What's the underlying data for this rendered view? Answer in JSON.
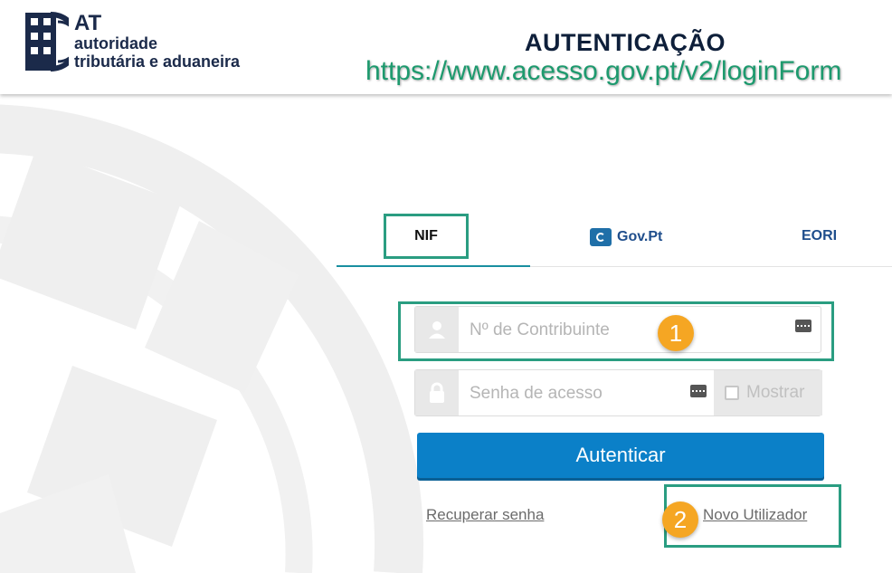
{
  "header": {
    "logo": {
      "abbr": "AT",
      "line1": "autoridade",
      "line2": "tributária e aduaneira"
    },
    "title": "AUTENTICAÇÃO",
    "url": "https://www.acesso.gov.pt/v2/loginForm"
  },
  "tabs": [
    {
      "label": "NIF",
      "active": true
    },
    {
      "label": "Gov.Pt",
      "icon": "govpt-logo-icon"
    },
    {
      "label": "EORI"
    }
  ],
  "form": {
    "nif": {
      "placeholder": "Nº de Contribuinte",
      "value": "",
      "icon": "user-icon",
      "keypad_icon": "keypad-icon"
    },
    "password": {
      "placeholder": "Senha de acesso",
      "value": "",
      "icon": "lock-icon",
      "keypad_icon": "keypad-icon"
    },
    "show_label": "Mostrar",
    "submit_label": "Autenticar",
    "recover_label": "Recuperar senha",
    "new_user_label": "Novo Utilizador"
  },
  "annotations": [
    {
      "number": "1"
    },
    {
      "number": "2"
    }
  ],
  "colors": {
    "accent": "#0b80c8",
    "highlight": "#2a9d81",
    "badge": "#f5a623",
    "url_text": "#1d9a6e",
    "tab_text": "#1f4e8c"
  }
}
